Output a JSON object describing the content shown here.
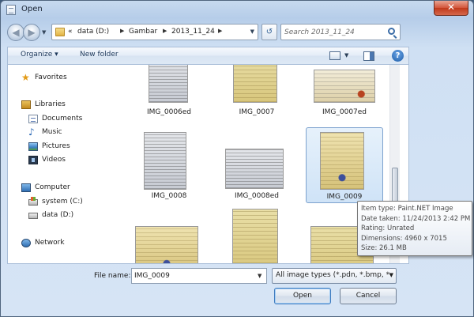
{
  "window": {
    "title": "Open",
    "close_label": "✕"
  },
  "nav": {
    "back_label": "◀",
    "forward_label": "▶",
    "breadcrumb": [
      "«",
      "data (D:)",
      "Gambar",
      "2013_11_24"
    ],
    "search_placeholder": "Search 2013_11_24"
  },
  "toolbar": {
    "organize_label": "Organize ▾",
    "new_folder_label": "New folder",
    "help_label": "?"
  },
  "sidebar": {
    "favorites": "Favorites",
    "libraries": "Libraries",
    "library_items": [
      "Documents",
      "Music",
      "Pictures",
      "Videos"
    ],
    "computer": "Computer",
    "drives": [
      "system (C:)",
      "data (D:)"
    ],
    "network": "Network"
  },
  "files": [
    {
      "name": "IMG_0006ed",
      "selected": false
    },
    {
      "name": "IMG_0007",
      "selected": false
    },
    {
      "name": "IMG_0007ed",
      "selected": false
    },
    {
      "name": "IMG_0008",
      "selected": false
    },
    {
      "name": "IMG_0008ed",
      "selected": false
    },
    {
      "name": "IMG_0009",
      "selected": true
    },
    {
      "name": "",
      "selected": false
    },
    {
      "name": "",
      "selected": false
    },
    {
      "name": "",
      "selected": false
    }
  ],
  "tooltip": {
    "item_type": "Item type: Paint.NET Image",
    "date_taken": "Date taken: 11/24/2013 2:42 PM",
    "rating": "Rating: Unrated",
    "dimensions": "Dimensions: 4960 x 7015",
    "size": "Size: 26.1 MB"
  },
  "footer": {
    "file_name_label": "File name:",
    "file_name_value": "IMG_0009",
    "file_type_value": "All image types (*.pdn, *.bmp, *",
    "open_label": "Open",
    "cancel_label": "Cancel"
  }
}
